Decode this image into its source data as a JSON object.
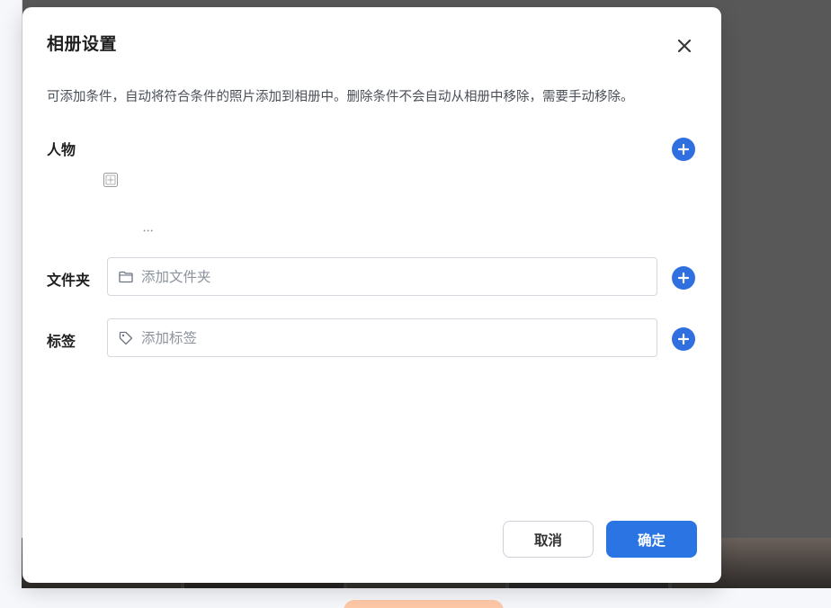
{
  "dialog": {
    "title": "相册设置",
    "description": "可添加条件，自动将符合条件的照片添加到相册中。删除条件不会自动从相册中移除，需要手动移除。",
    "person": {
      "label": "人物",
      "name": "ꞏꞏꞏ"
    },
    "folder": {
      "label": "文件夹",
      "placeholder": "添加文件夹"
    },
    "tag": {
      "label": "标签",
      "placeholder": "添加标签"
    },
    "buttons": {
      "cancel": "取消",
      "confirm": "确定"
    }
  },
  "colors": {
    "accent": "#2a74e3",
    "add_button": "#2f6fe0",
    "text_primary": "#1f1f1f",
    "text_secondary": "#4a4f57",
    "placeholder": "#8c939d",
    "border": "#d3d8df"
  },
  "icons": {
    "close": "close-icon",
    "add": "plus-circle-icon",
    "folder": "folder-icon",
    "tag": "tag-icon",
    "person_placeholder": "image-placeholder-icon"
  }
}
